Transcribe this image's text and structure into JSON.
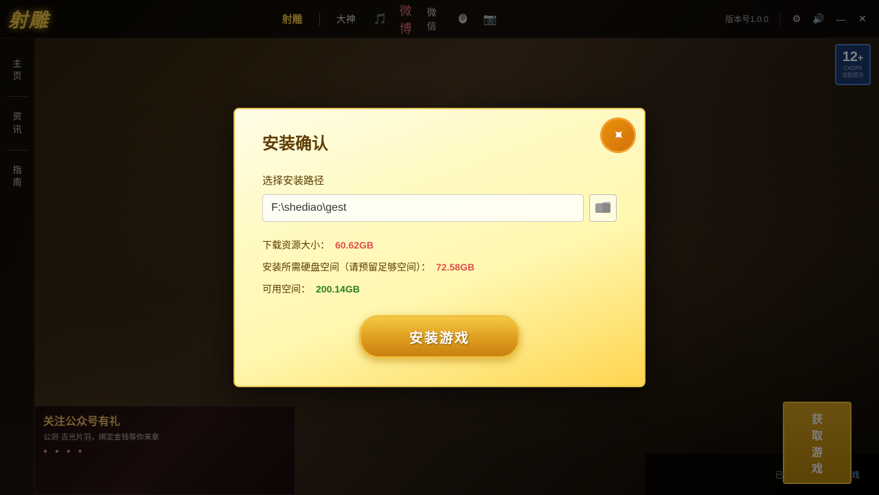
{
  "topbar": {
    "logo": "射雕",
    "nav_items": [
      "射雕",
      "大神",
      "🎵",
      "微博",
      "微信",
      "QQ",
      "📷"
    ],
    "version_label": "版本号1.0.0",
    "settings_icon": "⚙",
    "volume_icon": "🔊",
    "minimize_icon": "—",
    "close_icon": "✕"
  },
  "sidebar": {
    "items": [
      {
        "label": "主\n页",
        "id": "home"
      },
      {
        "label": "资\n讯",
        "id": "news"
      },
      {
        "label": "指\n南",
        "id": "guide"
      }
    ]
  },
  "rating": {
    "number": "12",
    "plus": "+",
    "label": "CADPA\n适龄提示"
  },
  "dialog": {
    "title": "安装确认",
    "close_label": "✕",
    "path_label": "选择安装路径",
    "path_value": "F:\\shediao\\gest",
    "folder_icon": "📁",
    "download_size_label": "下载资源大小：",
    "download_size_value": "60.62GB",
    "disk_size_label": "安装所需硬盘空间（请预留足够空间）：",
    "disk_size_value": "72.58GB",
    "free_space_label": "可用空间：",
    "free_space_value": "200.14GB",
    "install_btn_label": "安装游戏"
  },
  "banner": {
    "title": "关注公众号有礼",
    "subtitle": "公测·吉光片羽，绑定金钱等你来拿",
    "dots": "● ● ● ●"
  },
  "bottombar": {
    "get_game_label": "获取游戏",
    "installed_text": "已安装游戏？",
    "locate_label": "定位游戏"
  }
}
